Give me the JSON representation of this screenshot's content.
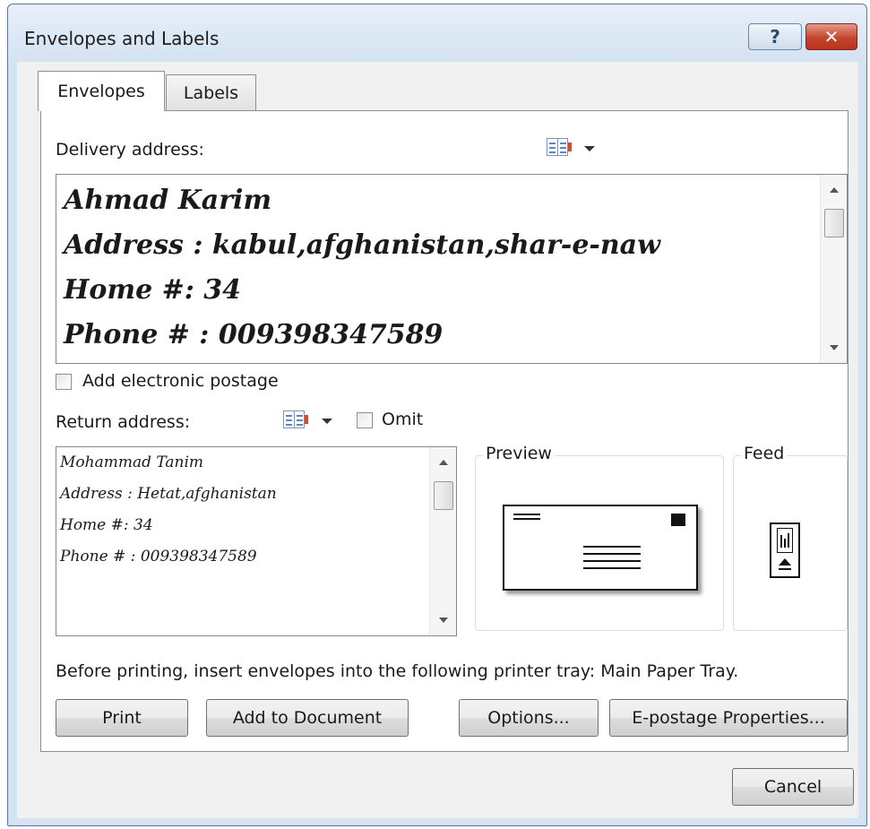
{
  "window": {
    "title": "Envelopes and Labels"
  },
  "titlebar": {
    "help_glyph": "?",
    "close_glyph": "✕"
  },
  "tabs": [
    {
      "label": "Envelopes",
      "active": true
    },
    {
      "label": "Labels",
      "active": false
    }
  ],
  "delivery": {
    "label": "Delivery address:",
    "lines": [
      "Ahmad Karim",
      "Address : kabul,afghanistan,shar-e-naw",
      "Home #: 34",
      "Phone # : 009398347589"
    ]
  },
  "electronic_postage": {
    "label": "Add electronic postage",
    "checked": false
  },
  "return": {
    "label": "Return address:",
    "omit_label": "Omit",
    "omit_checked": false,
    "lines": [
      "Mohammad Tanim",
      "Address : Hetat,afghanistan",
      "Home #: 34",
      "Phone # : 009398347589"
    ]
  },
  "preview": {
    "label": "Preview"
  },
  "feed": {
    "label": "Feed"
  },
  "tray_message": "Before printing, insert envelopes into the following printer tray: Main Paper Tray.",
  "buttons": {
    "print": "Print",
    "add_to_document": "Add to Document",
    "options": "Options...",
    "epostage": "E-postage Properties...",
    "cancel": "Cancel"
  },
  "icons": {
    "address_book": "address-book-icon",
    "dropdown": "chevron-down-icon"
  }
}
